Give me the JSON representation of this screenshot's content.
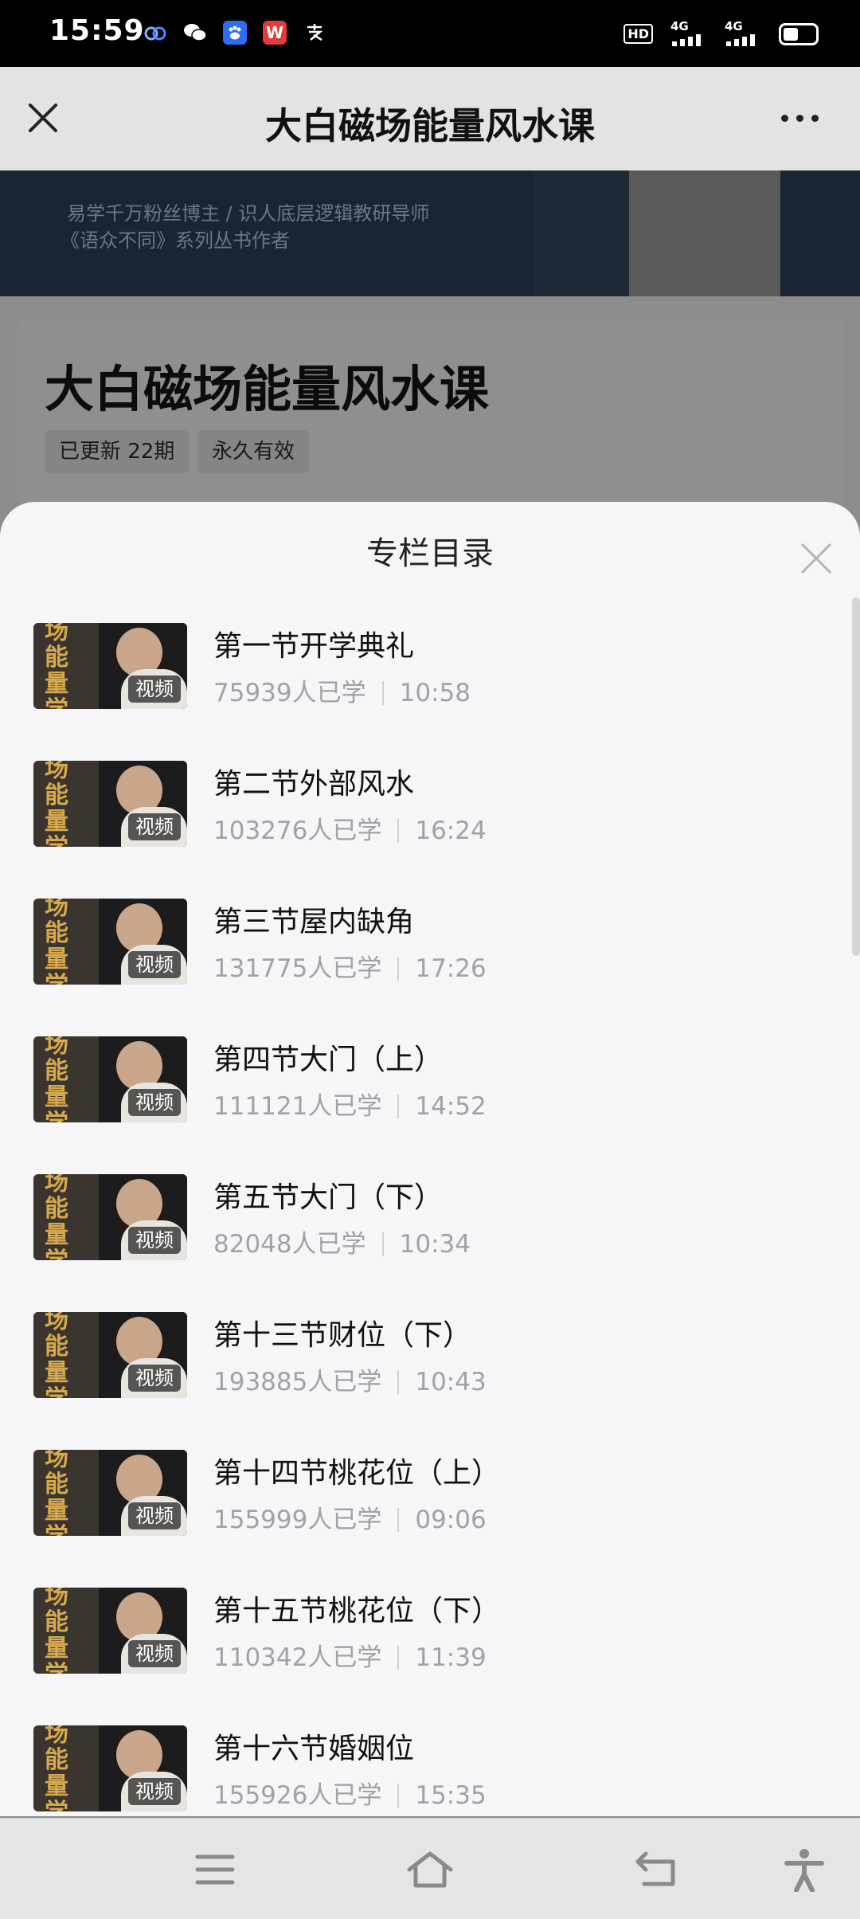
{
  "status_bar": {
    "time": "15:59",
    "app_icons": [
      "baidu-netdisk-icon",
      "wechat-icon",
      "baidu-icon",
      "wps-icon",
      "alipay-icon"
    ],
    "right_indicators": [
      "HD",
      "4G",
      "4G"
    ]
  },
  "title_bar": {
    "title": "大白磁场能量风水课"
  },
  "background": {
    "banner_line1": "易学千万粉丝博主 / 识人底层逻辑教研导师",
    "banner_line2": "《语众不同》系列丛书作者",
    "course_title": "大白磁场能量风水课",
    "tags": [
      "已更新 22期",
      "永久有效"
    ]
  },
  "sheet": {
    "title": "专栏目录",
    "thumb_text": "场能量学",
    "items": [
      {
        "title": "第一节开学典礼",
        "learners": "75939人已学",
        "duration": "10:58",
        "badge": "视频"
      },
      {
        "title": "第二节外部风水",
        "learners": "103276人已学",
        "duration": "16:24",
        "badge": "视频"
      },
      {
        "title": "第三节屋内缺角",
        "learners": "131775人已学",
        "duration": "17:26",
        "badge": "视频"
      },
      {
        "title": "第四节大门（上）",
        "learners": "111121人已学",
        "duration": "14:52",
        "badge": "视频"
      },
      {
        "title": "第五节大门（下）",
        "learners": "82048人已学",
        "duration": "10:34",
        "badge": "视频"
      },
      {
        "title": "第十三节财位（下）",
        "learners": "193885人已学",
        "duration": "10:43",
        "badge": "视频"
      },
      {
        "title": "第十四节桃花位（上）",
        "learners": "155999人已学",
        "duration": "09:06",
        "badge": "视频"
      },
      {
        "title": "第十五节桃花位（下）",
        "learners": "110342人已学",
        "duration": "11:39",
        "badge": "视频"
      },
      {
        "title": "第十六节婚姻位",
        "learners": "155926人已学",
        "duration": "15:35",
        "badge": "视频"
      }
    ]
  },
  "navigation": {
    "buttons": [
      "menu-icon",
      "home-icon",
      "back-icon",
      "accessibility-icon"
    ]
  }
}
